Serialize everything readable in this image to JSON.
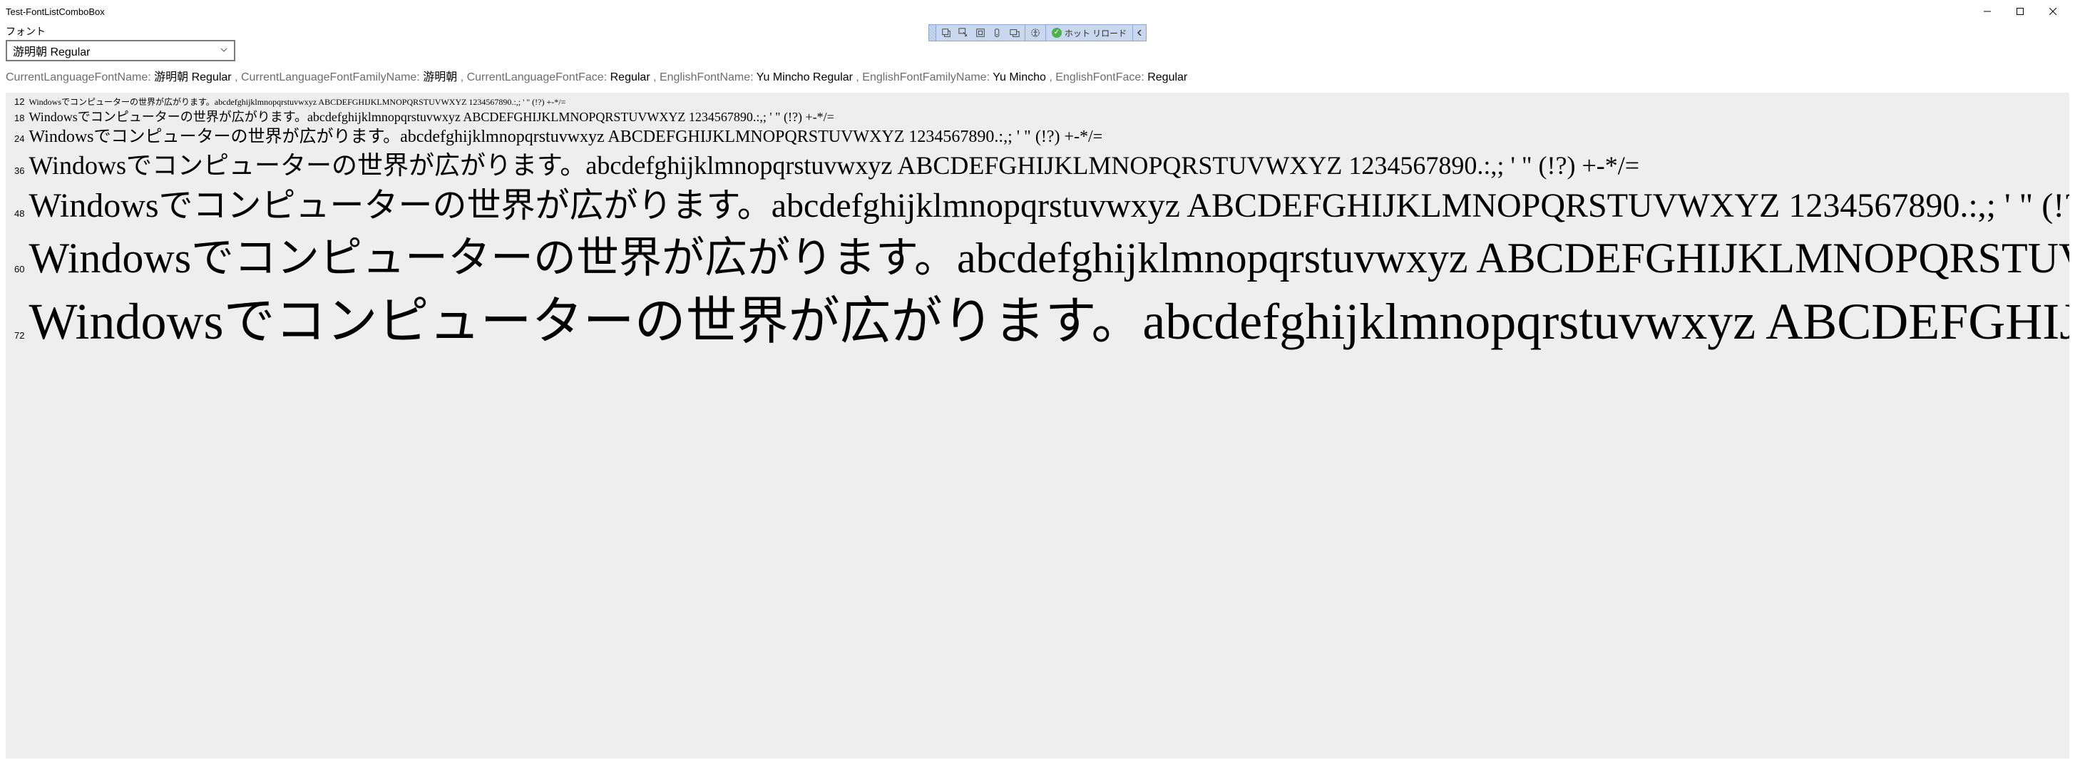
{
  "window": {
    "title": "Test-FontListComboBox"
  },
  "debugbar": {
    "hot_reload_label": "ホット リロード"
  },
  "form": {
    "font_label": "フォント",
    "selected_font": "游明朝 Regular"
  },
  "info": {
    "CurrentLanguageFontName_label": "CurrentLanguageFontName:",
    "CurrentLanguageFontName_value": "游明朝 Regular",
    "CurrentLanguageFontFamilyName_label": "CurrentLanguageFontFamilyName:",
    "CurrentLanguageFontFamilyName_value": "游明朝",
    "CurrentLanguageFontFace_label": "CurrentLanguageFontFace:",
    "CurrentLanguageFontFace_value": "Regular",
    "EnglishFontName_label": "EnglishFontName:",
    "EnglishFontName_value": "Yu Mincho Regular",
    "EnglishFontFamilyName_label": "EnglishFontFamilyName:",
    "EnglishFontFamilyName_value": "Yu Mincho",
    "EnglishFontFace_label": "EnglishFontFace:",
    "EnglishFontFace_value": "Regular"
  },
  "preview": {
    "sample_text": "Windowsでコンピューターの世界が広がります。abcdefghijklmnopqrstuvwxyz ABCDEFGHIJKLMNOPQRSTUVWXYZ 1234567890.:,; ' \" (!?) +-*/=",
    "sizes": [
      12,
      18,
      24,
      36,
      48,
      60,
      72
    ]
  }
}
